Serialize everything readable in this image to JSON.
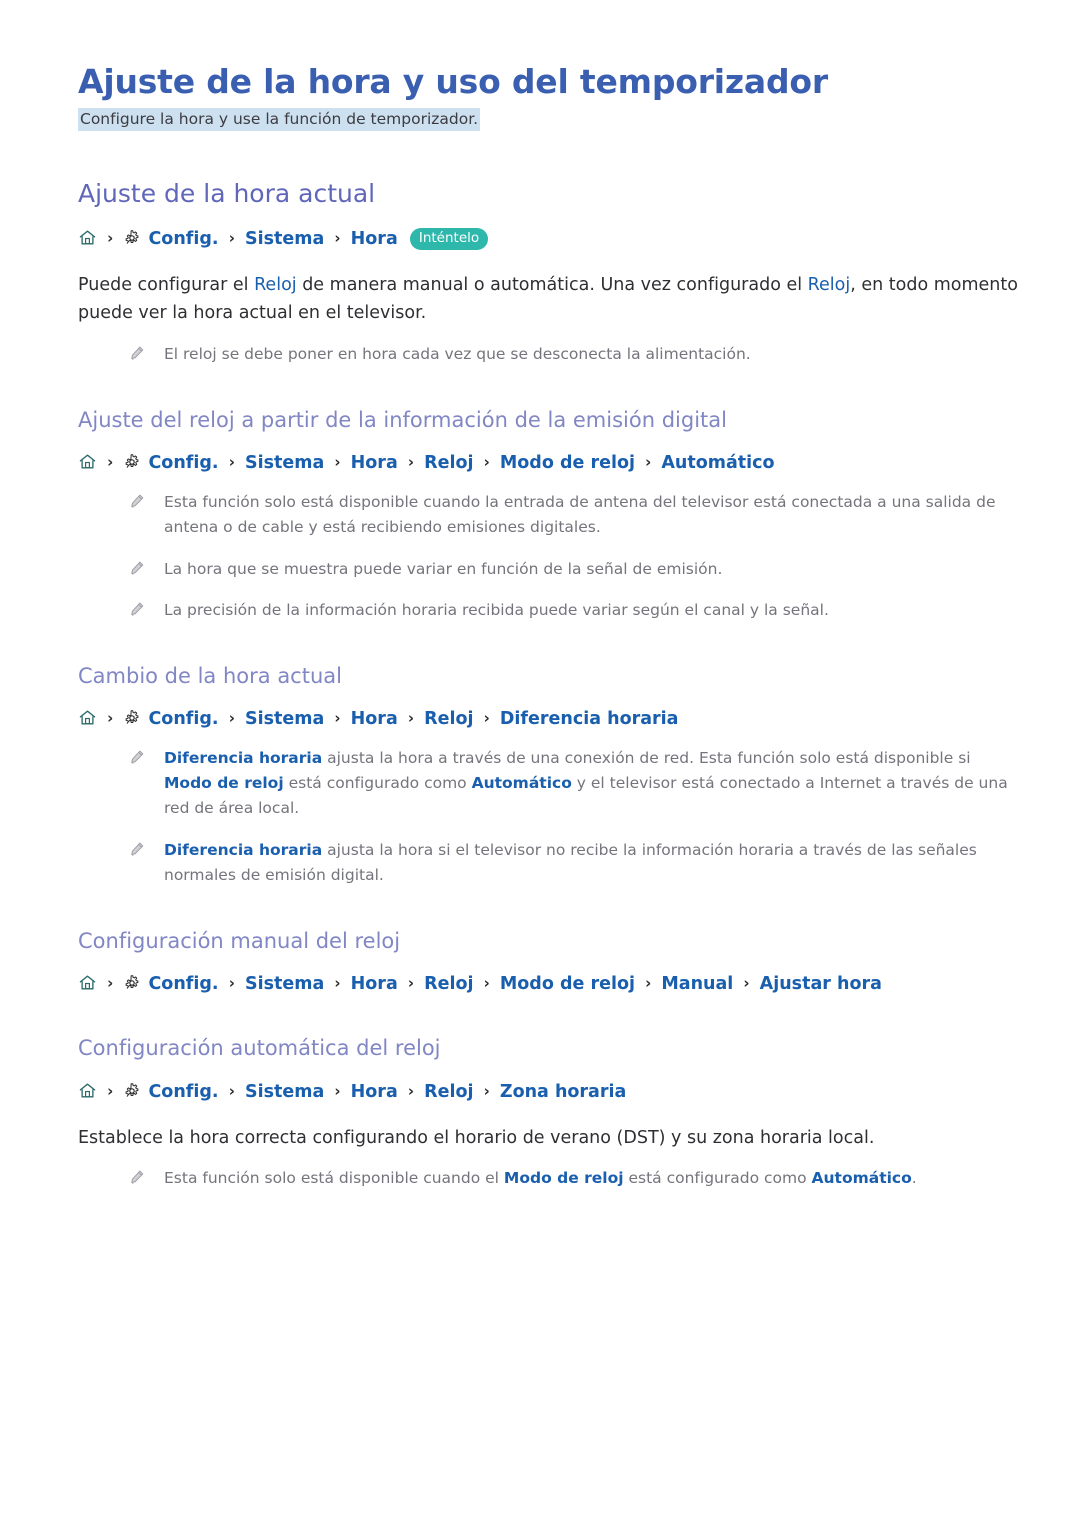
{
  "document": {
    "title": "Ajuste de la hora y uso del temporizador",
    "subtitle": "Configure la hora y use la función de temporizador."
  },
  "colors": {
    "title": "#3b5fb0",
    "heading2": "#6167b8",
    "heading3": "#8186c4",
    "link": "#1a5fae",
    "badge": "#2eb7ab",
    "highlight": "#cde0ef",
    "note_text": "#74747c",
    "body_text": "#2f2f33"
  },
  "sections": [
    {
      "id": "ajuste-hora-actual",
      "level": 2,
      "heading": "Ajuste de la hora actual",
      "breadcrumb": {
        "home_icon": "home-icon",
        "gear_icon": "gear-icon",
        "separator": "›",
        "crumbs": [
          "Config.",
          "Sistema",
          "Hora"
        ],
        "badge": "Inténtelo"
      },
      "paragraph": {
        "p1": "Puede configurar el ",
        "t1": "Reloj",
        "p2": " de manera manual o automática. Una vez configurado el ",
        "t2": "Reloj",
        "p3": ", en todo momento puede ver la hora actual en el televisor."
      },
      "notes": [
        {
          "text": "El reloj se debe poner en hora cada vez que se desconecta la alimentación."
        }
      ]
    },
    {
      "id": "ajuste-reloj-emision-digital",
      "level": 3,
      "heading": "Ajuste del reloj a partir de la información de la emisión digital",
      "breadcrumb": {
        "crumbs": [
          "Config.",
          "Sistema",
          "Hora",
          "Reloj",
          "Modo de reloj",
          "Automático"
        ]
      },
      "notes": [
        {
          "text": "Esta función solo está disponible cuando la entrada de antena del televisor está conectada a una salida de antena o de cable y está recibiendo emisiones digitales."
        },
        {
          "text": "La hora que se muestra puede variar en función de la señal de emisión."
        },
        {
          "text": "La precisión de la información horaria recibida puede variar según el canal y la señal."
        }
      ]
    },
    {
      "id": "cambio-hora-actual",
      "level": 3,
      "heading": "Cambio de la hora actual",
      "breadcrumb": {
        "crumbs": [
          "Config.",
          "Sistema",
          "Hora",
          "Reloj",
          "Diferencia horaria"
        ]
      },
      "notes": [
        {
          "parts": [
            {
              "type": "term",
              "text": "Diferencia horaria"
            },
            {
              "type": "plain",
              "text": " ajusta la hora a través de una conexión de red. Esta función solo está disponible si "
            },
            {
              "type": "term",
              "text": "Modo de reloj"
            },
            {
              "type": "plain",
              "text": " está configurado como "
            },
            {
              "type": "term",
              "text": "Automático"
            },
            {
              "type": "plain",
              "text": " y el televisor está conectado a Internet a través de una red de área local."
            }
          ]
        },
        {
          "parts": [
            {
              "type": "term",
              "text": "Diferencia horaria"
            },
            {
              "type": "plain",
              "text": " ajusta la hora si el televisor no recibe la información horaria a través de las señales normales de emisión digital."
            }
          ]
        }
      ]
    },
    {
      "id": "configuracion-manual-reloj",
      "level": 3,
      "heading": "Configuración manual del reloj",
      "breadcrumb": {
        "crumbs": [
          "Config.",
          "Sistema",
          "Hora",
          "Reloj",
          "Modo de reloj",
          "Manual",
          "Ajustar hora"
        ]
      },
      "notes": []
    },
    {
      "id": "configuracion-automatica-reloj",
      "level": 3,
      "heading": "Configuración automática del reloj",
      "breadcrumb": {
        "crumbs": [
          "Config.",
          "Sistema",
          "Hora",
          "Reloj",
          "Zona horaria"
        ]
      },
      "paragraph_plain": "Establece la hora correcta configurando el horario de verano (DST) y su zona horaria local.",
      "notes": [
        {
          "parts": [
            {
              "type": "plain",
              "text": "Esta función solo está disponible cuando el "
            },
            {
              "type": "term",
              "text": "Modo de reloj"
            },
            {
              "type": "plain",
              "text": " está configurado como "
            },
            {
              "type": "term",
              "text": "Automático"
            },
            {
              "type": "plain",
              "text": "."
            }
          ]
        }
      ]
    }
  ]
}
